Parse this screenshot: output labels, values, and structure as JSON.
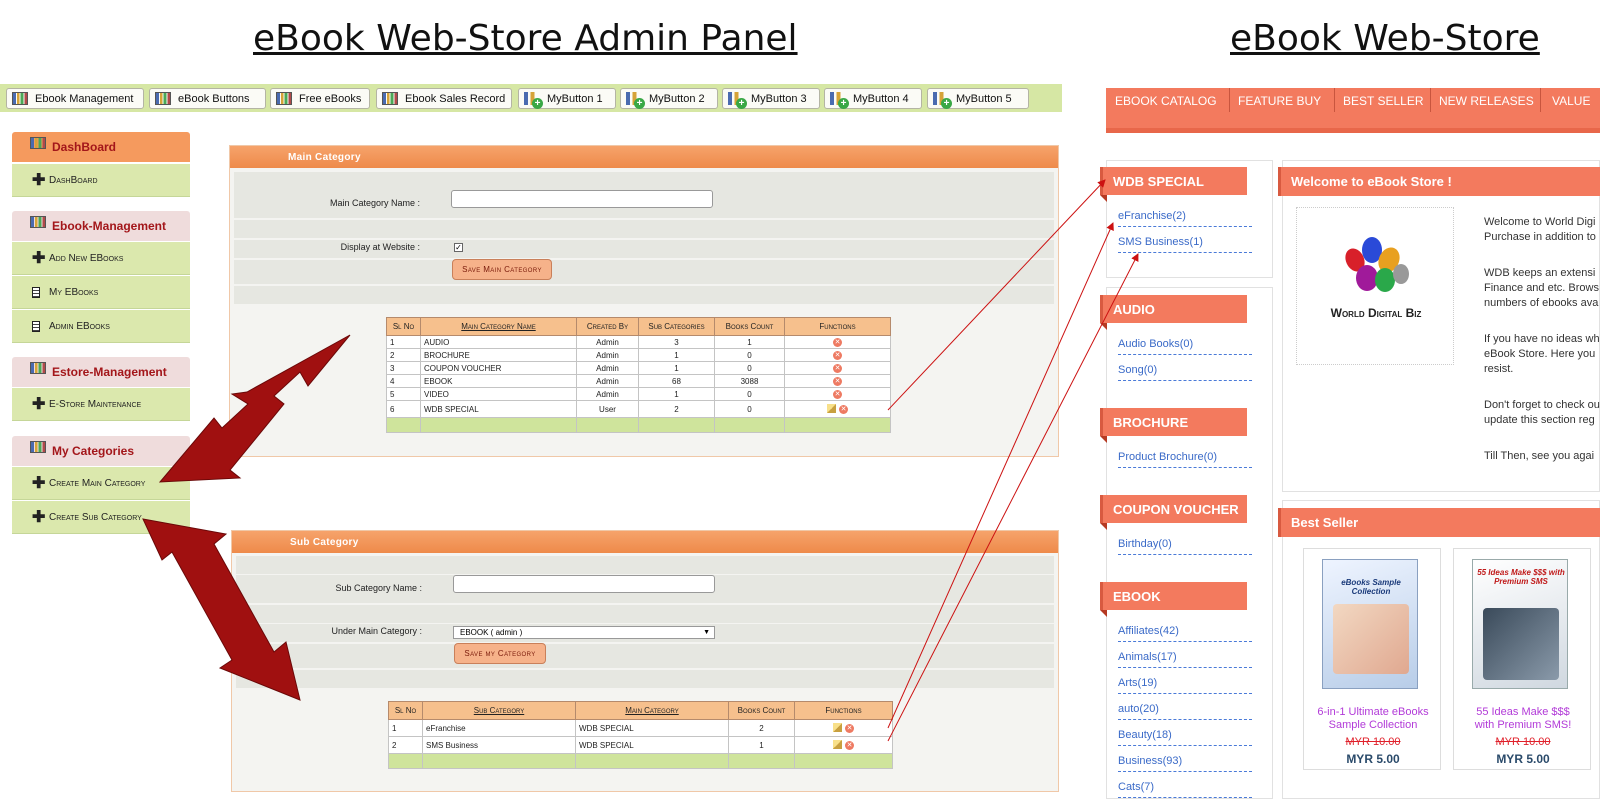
{
  "headings": {
    "admin": "eBook Web-Store Admin Panel",
    "store": "eBook Web-Store"
  },
  "topbar": {
    "buttons": [
      {
        "label": "Ebook Management",
        "icon": "bar-chart-icon"
      },
      {
        "label": "eBook Buttons",
        "icon": "bar-chart-icon"
      },
      {
        "label": "Free eBooks",
        "icon": "bar-chart-icon"
      },
      {
        "label": "Ebook Sales Record",
        "icon": "bar-chart-icon"
      },
      {
        "label": "MyButton 1",
        "icon": "add-chart-icon"
      },
      {
        "label": "MyButton 2",
        "icon": "add-chart-icon"
      },
      {
        "label": "MyButton 3",
        "icon": "add-chart-icon"
      },
      {
        "label": "MyButton 4",
        "icon": "add-chart-icon"
      },
      {
        "label": "MyButton 5",
        "icon": "add-chart-icon"
      }
    ]
  },
  "sidebar": {
    "sections": [
      {
        "title": "DashBoard",
        "items": [
          {
            "label": "DashBoard",
            "icon": "plus-icon"
          }
        ]
      },
      {
        "title": "Ebook-Management",
        "items": [
          {
            "label": "Add New EBooks",
            "icon": "plus-icon"
          },
          {
            "label": "My EBooks",
            "icon": "document-icon"
          },
          {
            "label": "Admin EBooks",
            "icon": "document-icon"
          }
        ]
      },
      {
        "title": "Estore-Management",
        "items": [
          {
            "label": "E-Store Maintenance",
            "icon": "plus-icon"
          }
        ]
      },
      {
        "title": "My Categories",
        "items": [
          {
            "label": "Create Main Category",
            "icon": "plus-icon"
          },
          {
            "label": "Create Sub Category",
            "icon": "plus-icon"
          }
        ]
      }
    ]
  },
  "main_category": {
    "title": "Main Category",
    "name_label": "Main Category Name :",
    "name_value": "",
    "display_label": "Display at Website :",
    "display_checked": true,
    "save_label": "Save Main Category",
    "table": {
      "headers": [
        "Sl No",
        "Main Category Name",
        "Created By",
        "Sub Categories",
        "Books Count",
        "Functions"
      ],
      "rows": [
        [
          "1",
          "AUDIO",
          "Admin",
          "3",
          "1"
        ],
        [
          "2",
          "BROCHURE",
          "Admin",
          "1",
          "0"
        ],
        [
          "3",
          "COUPON VOUCHER",
          "Admin",
          "1",
          "0"
        ],
        [
          "4",
          "EBOOK",
          "Admin",
          "68",
          "3088"
        ],
        [
          "5",
          "VIDEO",
          "Admin",
          "1",
          "0"
        ],
        [
          "6",
          "WDB SPECIAL",
          "User",
          "2",
          "0"
        ]
      ]
    }
  },
  "sub_category": {
    "title": "Sub Category",
    "name_label": "Sub Category Name :",
    "name_value": "",
    "under_label": "Under Main Category :",
    "under_value": "EBOOK ( admin )",
    "save_label": "Save my Category",
    "table": {
      "headers": [
        "Sl No",
        "Sub Category",
        "Main Category",
        "Books Count",
        "Functions"
      ],
      "rows": [
        [
          "1",
          "eFranchise",
          "WDB SPECIAL",
          "2"
        ],
        [
          "2",
          "SMS Business",
          "WDB SPECIAL",
          "1"
        ]
      ]
    }
  },
  "store": {
    "nav": [
      "EBOOK CATALOG",
      "FEATURE BUY",
      "BEST SELLER",
      "NEW RELEASES",
      "VALUE"
    ],
    "categories": [
      {
        "title": "WDB SPECIAL",
        "links": [
          "eFranchise(2)",
          "SMS Business(1)"
        ]
      },
      {
        "title": "AUDIO",
        "links": [
          "Audio Books(0)",
          "Song(0)"
        ]
      },
      {
        "title": "BROCHURE",
        "links": [
          "Product Brochure(0)"
        ]
      },
      {
        "title": "COUPON VOUCHER",
        "links": [
          "Birthday(0)"
        ]
      },
      {
        "title": "EBOOK",
        "links": [
          "Affiliates(42)",
          "Animals(17)",
          "Arts(19)",
          "auto(20)",
          "Beauty(18)",
          "Business(93)",
          "Cats(7)"
        ]
      }
    ],
    "welcome": {
      "title": "Welcome to eBook Store !",
      "logo_text": "World Digital Biz",
      "lines": [
        "Welcome to World Digi",
        "Purchase in addition to",
        "",
        "WDB keeps an extensi",
        "Finance and etc. Brows",
        "numbers of ebooks ava",
        "",
        "If you have no ideas wh",
        "eBook Store. Here you",
        "resist.",
        "",
        "Don't forget to check ou",
        "update this section reg",
        "",
        "Till Then, see you agai"
      ]
    },
    "best_seller": {
      "title": "Best Seller",
      "products": [
        {
          "cover_title": "eBooks Sample Collection",
          "name_line1": "6-in-1 Ultimate eBooks",
          "name_line2": "Sample Collection",
          "old_price": "MYR 10.00",
          "price": "MYR 5.00"
        },
        {
          "cover_title": "55 Ideas Make $$$ with Premium SMS",
          "name_line1": "55 Ideas Make $$$",
          "name_line2": "with Premium SMS!",
          "old_price": "MYR 10.00",
          "price": "MYR 5.00"
        }
      ]
    }
  },
  "colors": {
    "accent": "#f37a5e",
    "panel_head": "#ee8a4a",
    "sidebar_item": "#dbe8ad",
    "arrow": "#a01010",
    "link": "#3a6ac8"
  }
}
